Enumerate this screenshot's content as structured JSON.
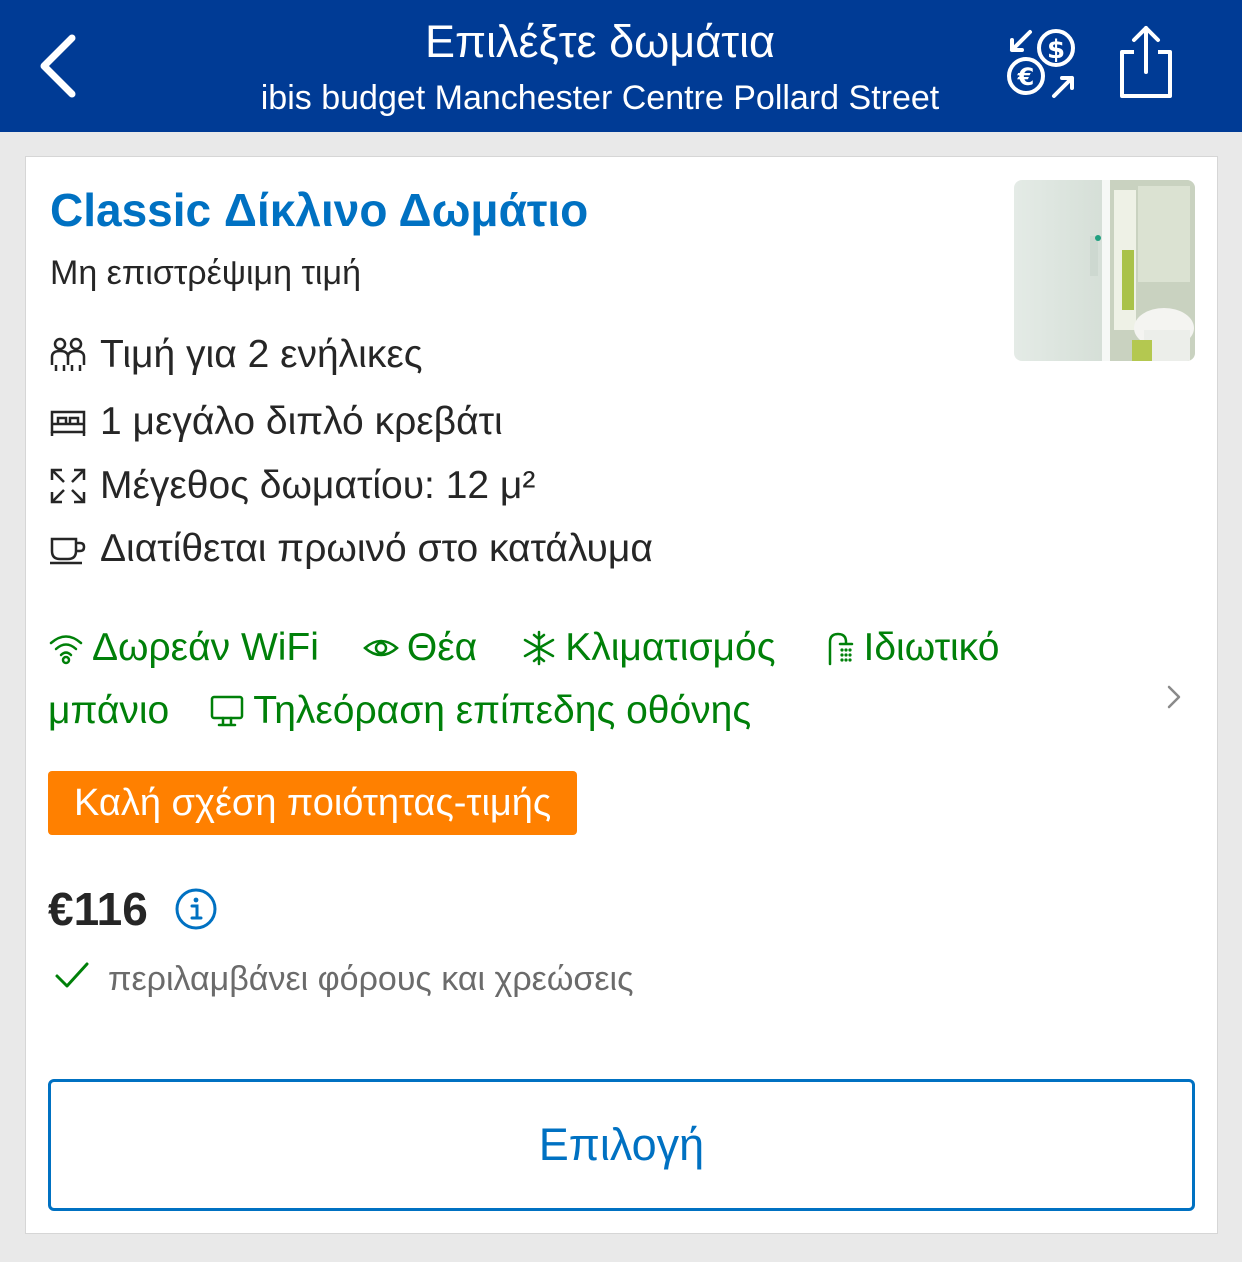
{
  "header": {
    "title": "Επιλέξτε δωμάτια",
    "subtitle": "ibis budget Manchester Centre Pollard Street",
    "background": "#003b95",
    "icons": {
      "back": "chevron-left-icon",
      "currency": "currency-exchange-icon",
      "share": "share-icon"
    }
  },
  "room": {
    "title": "Classic Δίκλινο Δωμάτιο",
    "rate_type": "Μη επιστρέψιμη τιμή",
    "photo": "bathroom-photo",
    "facts": [
      {
        "icon": "adults-icon",
        "text": "Τιμή για 2 ενήλικες"
      },
      {
        "icon": "bed-icon",
        "text": "1 μεγάλο διπλό κρεβάτι"
      },
      {
        "icon": "resize-icon",
        "text": "Μέγεθος δωματίου: 12 μ²"
      },
      {
        "icon": "coffee-cup-icon",
        "text": "Διατίθεται πρωινό στο κατάλυμα"
      }
    ],
    "amenities": [
      {
        "icon": "wifi-icon",
        "text": "Δωρεάν WiFi"
      },
      {
        "icon": "eye-icon",
        "text": "Θέα"
      },
      {
        "icon": "snowflake-icon",
        "text": "Κλιματισμός"
      },
      {
        "icon": "shower-icon",
        "text": "Ιδιωτικό"
      },
      {
        "icon": "",
        "text": "μπάνιο"
      },
      {
        "icon": "tv-icon",
        "text": "Τηλεόραση επίπεδης οθόνης"
      }
    ],
    "badge": "Καλή σχέση ποιότητας-τιμής",
    "price": "€116",
    "taxes_note": "περιλαμβάνει φόρους και χρεώσεις",
    "select_label": "Επιλογή"
  },
  "colors": {
    "accent_blue": "#0071c2",
    "amenity_green": "#008009",
    "badge_orange": "#ff8000"
  }
}
